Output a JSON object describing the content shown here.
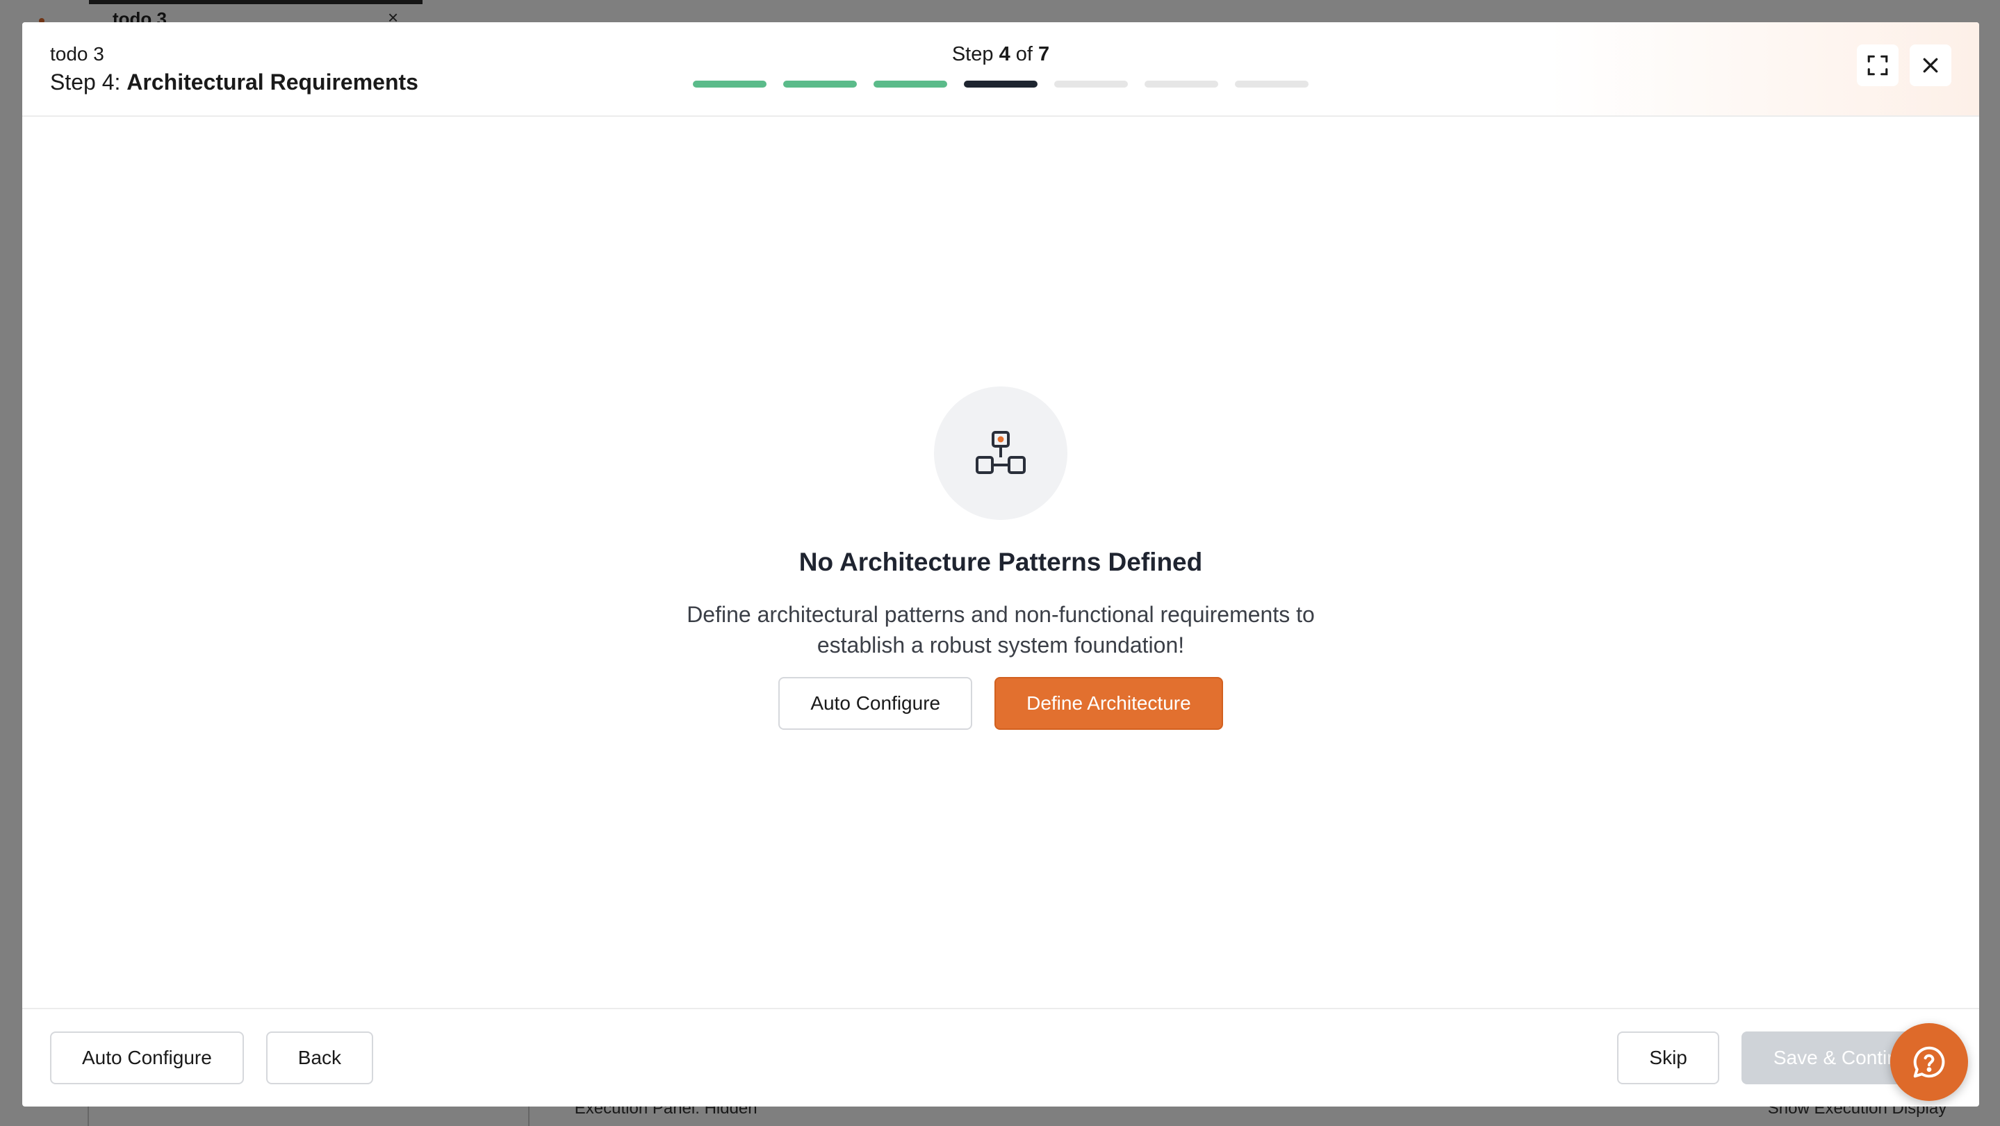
{
  "background": {
    "tab_label": "todo 3",
    "tab_close": "×",
    "execution_panel": "⌃  Execution Panel: Hidden",
    "show_execution": "Show Execution Display ⌃"
  },
  "header": {
    "project_name": "todo 3",
    "step_prefix": "Step 4: ",
    "step_name": "Architectural Requirements",
    "step_word": "Step ",
    "step_current": "4",
    "step_of": " of ",
    "step_total": "7",
    "progress": {
      "total_steps": 7,
      "completed": 3,
      "current": 4
    }
  },
  "empty_state": {
    "icon": "architecture-blocks-icon",
    "title": "No Architecture Patterns Defined",
    "description_line1": "Define architectural patterns and non-functional requirements to",
    "description_line2": "establish a robust system foundation!",
    "auto_configure_label": "Auto Configure",
    "define_label": "Define Architecture"
  },
  "footer": {
    "auto_configure_label": "Auto Configure",
    "back_label": "Back",
    "skip_label": "Skip",
    "save_continue_label": "Save & Continue"
  },
  "colors": {
    "accent": "#e2702f",
    "progress_done": "#5bbb8a",
    "progress_current": "#1e2530",
    "progress_pending": "#e6e6e6"
  }
}
